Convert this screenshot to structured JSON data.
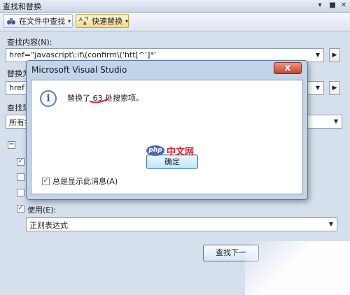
{
  "window": {
    "title": "查找和替换",
    "controls": [
      "▾",
      "■",
      "✕"
    ]
  },
  "toolbar": {
    "find_in_files": "在文件中查找",
    "quick_replace": "快速替换"
  },
  "find": {
    "label": "查找内容(N):",
    "value": "href=\"javascript\\:if\\(confirm\\('htt[^']*'"
  },
  "replace": {
    "label_partial": "替换为",
    "value_partial": "href"
  },
  "look_in": {
    "label_partial": "查找范",
    "value_partial": "所有打"
  },
  "options": {
    "use_label": "使用(E):",
    "use_value": "正则表达式"
  },
  "buttons": {
    "find_next_partial": "查找下一"
  },
  "dialog": {
    "title": "Microsoft Visual Studio",
    "close": "X",
    "message": "替换了 63 处搜索项。",
    "ok": "确定",
    "always_show": "总是显示此消息(A)"
  },
  "watermark": {
    "logo": "php",
    "text": "中文网"
  },
  "colors": {
    "title_bar": "#cdd7e6",
    "body": "#d6dfec",
    "dialog_frame": "#c2d4ea",
    "close_red": "#c6432a",
    "annotation_red": "#e4222a"
  }
}
